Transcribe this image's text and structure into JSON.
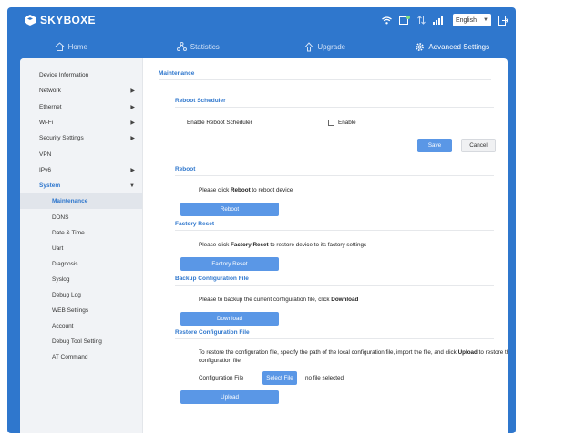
{
  "header": {
    "brand": "SKYBOXE",
    "language": "English"
  },
  "nav": [
    {
      "label": "Home",
      "icon": "home-icon"
    },
    {
      "label": "Statistics",
      "icon": "statistics-icon"
    },
    {
      "label": "Upgrade",
      "icon": "upgrade-icon"
    },
    {
      "label": "Advanced Settings",
      "icon": "gear-icon",
      "active": true
    }
  ],
  "sidebar": {
    "items": [
      {
        "label": "Device Information",
        "arrow": ""
      },
      {
        "label": "Network",
        "arrow": "▶"
      },
      {
        "label": "Ethernet",
        "arrow": "▶"
      },
      {
        "label": "Wi-Fi",
        "arrow": "▶"
      },
      {
        "label": "Security Settings",
        "arrow": "▶"
      },
      {
        "label": "VPN",
        "arrow": ""
      },
      {
        "label": "IPv6",
        "arrow": "▶"
      },
      {
        "label": "System",
        "arrow": "▼"
      }
    ],
    "sub_items": [
      "Maintenance",
      "DDNS",
      "Date & Time",
      "Uart",
      "Diagnosis",
      "Syslog",
      "Debug Log",
      "WEB Settings",
      "Account",
      "Debug Tool Setting",
      "AT Command"
    ]
  },
  "main": {
    "title": "Maintenance",
    "reboot_scheduler": {
      "title": "Reboot Scheduler",
      "label": "Enable Reboot Scheduler",
      "checkbox_label": "Enable",
      "save": "Save",
      "cancel": "Cancel"
    },
    "reboot": {
      "title": "Reboot",
      "text_pre": "Please click ",
      "text_bold": "Reboot",
      "text_post": " to reboot device",
      "button": "Reboot"
    },
    "factory_reset": {
      "title": "Factory Reset",
      "text_pre": "Please click ",
      "text_bold": "Factory Reset",
      "text_post": " to restore device to its factory settings",
      "button": "Factory Reset"
    },
    "backup": {
      "title": "Backup Configuration File",
      "text_pre": "Please to backup the current configuration file, click ",
      "text_bold": "Download",
      "button": "Download"
    },
    "restore": {
      "title": "Restore Configuration File",
      "text_pre": "To restore the configuration file, specify the path of the local configuration file, import the file, and click ",
      "text_bold": "Upload",
      "text_post": " to restore the configuration file",
      "file_label": "Configuration File",
      "select_button": "Select File",
      "file_status": "no file selected",
      "button": "Upload"
    }
  },
  "colors": {
    "brand_blue": "#2f77cd",
    "button_blue": "#5a97e6"
  }
}
